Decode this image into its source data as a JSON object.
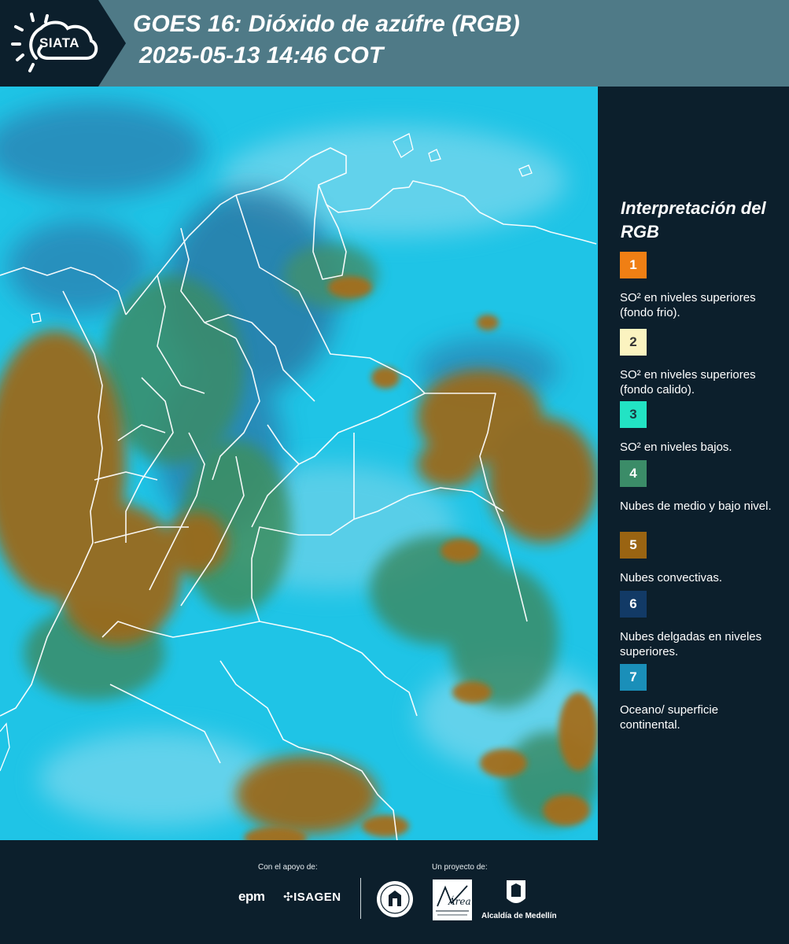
{
  "header": {
    "logo_text": "SIATA",
    "title_line1": "GOES 16: Dióxido de azúfre (RGB)",
    "title_line2": "2025-05-13 14:46 COT"
  },
  "legend": {
    "title": "Interpretación del RGB",
    "items": [
      {
        "number": "1",
        "label": "SO² en niveles superiores (fondo frio).",
        "color": "#f07f14",
        "text_color": "#ffffff"
      },
      {
        "number": "2",
        "label": "SO² en niveles superiores (fondo calido).",
        "color": "#fbf3c0",
        "text_color": "#333333"
      },
      {
        "number": "3",
        "label": "SO² en niveles bajos.",
        "color": "#22e3c4",
        "text_color": "#1a3a40"
      },
      {
        "number": "4",
        "label": "Nubes de medio y bajo nivel.",
        "color": "#3b8c68",
        "text_color": "#ffffff"
      },
      {
        "number": "5",
        "label": "Nubes convectivas.",
        "color": "#9a6412",
        "text_color": "#ffffff"
      },
      {
        "number": "6",
        "label": "Nubes delgadas en niveles superiores.",
        "color": "#123a66",
        "text_color": "#ffffff"
      },
      {
        "number": "7",
        "label": "Oceano/ superficie continental.",
        "color": "#1a8fb9",
        "text_color": "#ffffff"
      }
    ]
  },
  "footer": {
    "support_label": "Con el apoyo de:",
    "project_label": "Un proyecto de:",
    "sponsor_epm": "epm",
    "sponsor_isagen": "ISAGEN",
    "partner_area_metropolitana": "Área",
    "partner_alcaldia": "Alcaldía de Medellín"
  },
  "map": {
    "type": "satellite-rgb-composite",
    "region": "Colombia and northern South America",
    "colors": {
      "background": "#1fc4e6",
      "convective": "#9a6a1c",
      "low_cloud": "#3b8c68",
      "thin_cloud": "#2e7fb0",
      "borders": "#ffffff"
    }
  }
}
